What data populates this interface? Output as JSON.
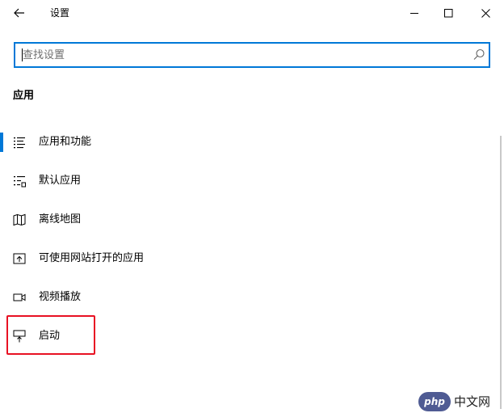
{
  "window": {
    "title": "设置"
  },
  "search": {
    "placeholder": "查找设置",
    "value": ""
  },
  "section": {
    "title": "应用"
  },
  "nav": {
    "items": [
      {
        "label": "应用和功能",
        "icon": "apps-list-icon",
        "selected": true
      },
      {
        "label": "默认应用",
        "icon": "default-apps-icon",
        "selected": false
      },
      {
        "label": "离线地图",
        "icon": "map-icon",
        "selected": false
      },
      {
        "label": "可使用网站打开的应用",
        "icon": "open-website-icon",
        "selected": false
      },
      {
        "label": "视频播放",
        "icon": "video-camera-icon",
        "selected": false
      },
      {
        "label": "启动",
        "icon": "startup-icon",
        "selected": false,
        "highlighted": true
      }
    ]
  },
  "watermark": {
    "badge": "php",
    "text": "中文网"
  },
  "colors": {
    "accent": "#0078d7",
    "highlight": "#e81123",
    "text": "#000000",
    "placeholder": "#707070"
  }
}
